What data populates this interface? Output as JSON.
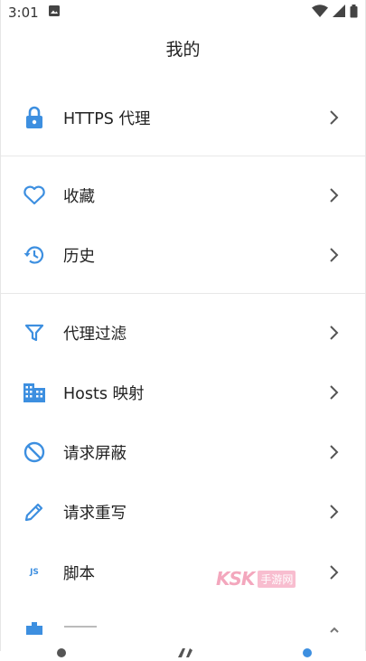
{
  "status_bar": {
    "time": "3:01"
  },
  "page": {
    "title": "我的"
  },
  "menu": {
    "https_proxy": "HTTPS 代理",
    "favorites": "收藏",
    "history": "历史",
    "proxy_filter": "代理过滤",
    "hosts_mapping": "Hosts 映射",
    "request_block": "请求屏蔽",
    "request_rewrite": "请求重写",
    "script": "脚本",
    "js_badge": "JS"
  },
  "watermark": {
    "brand": "KSK",
    "tag": "手游网"
  },
  "colors": {
    "accent": "#3d8fe0",
    "divider": "#e8e8e8",
    "text": "#222222"
  },
  "icons": [
    "lock-icon",
    "heart-icon",
    "history-icon",
    "filter-icon",
    "building-icon",
    "block-icon",
    "pencil-icon",
    "js-icon",
    "chevron-right-icon"
  ]
}
